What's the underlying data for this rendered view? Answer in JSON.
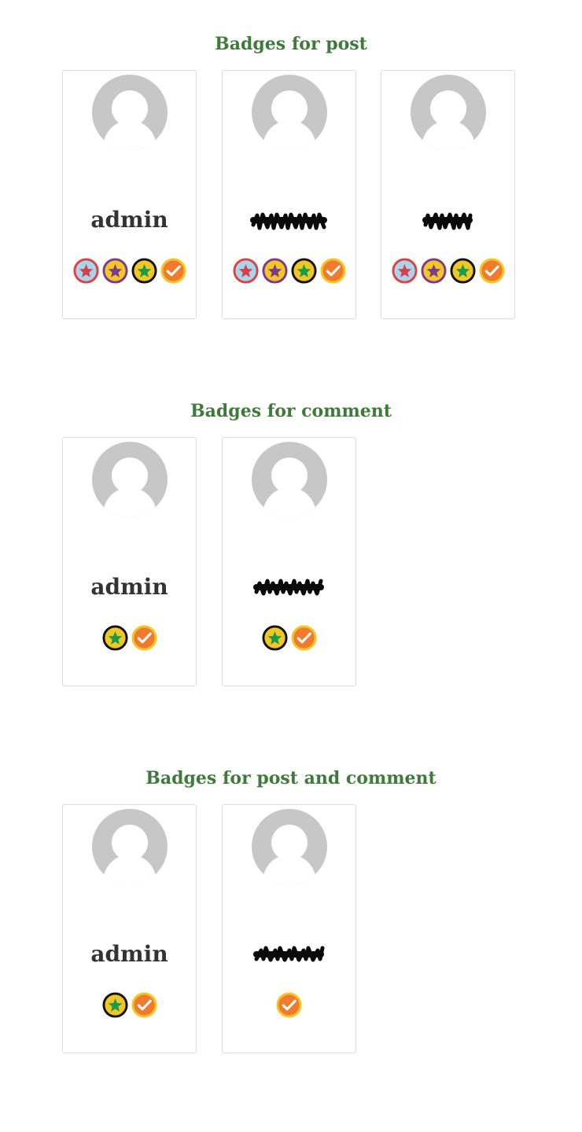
{
  "sections": [
    {
      "title": "Badges for post",
      "users": [
        {
          "name": "admin",
          "name_hidden": false,
          "badges": [
            "red-star-badge-icon",
            "purple-star-badge-icon",
            "green-star-badge-icon",
            "checkmark-badge-icon"
          ]
        },
        {
          "name": "",
          "name_hidden": true,
          "badges": [
            "red-star-badge-icon",
            "purple-star-badge-icon",
            "green-star-badge-icon",
            "checkmark-badge-icon"
          ]
        },
        {
          "name": "",
          "name_hidden": true,
          "badges": [
            "red-star-badge-icon",
            "purple-star-badge-icon",
            "green-star-badge-icon",
            "checkmark-badge-icon"
          ]
        }
      ]
    },
    {
      "title": "Badges for comment",
      "users": [
        {
          "name": "admin",
          "name_hidden": false,
          "badges": [
            "green-star-badge-icon",
            "checkmark-badge-icon"
          ]
        },
        {
          "name": "",
          "name_hidden": true,
          "badges": [
            "green-star-badge-icon",
            "checkmark-badge-icon"
          ]
        }
      ]
    },
    {
      "title": "Badges for post and comment",
      "users": [
        {
          "name": "admin",
          "name_hidden": false,
          "badges": [
            "green-star-badge-icon",
            "checkmark-badge-icon"
          ]
        },
        {
          "name": "",
          "name_hidden": true,
          "badges": [
            "checkmark-badge-icon"
          ]
        }
      ]
    }
  ],
  "colors": {
    "title": "#3f7a3a",
    "avatar": "#c7c7c7",
    "card_border": "#dddddd",
    "username": "#333333"
  }
}
